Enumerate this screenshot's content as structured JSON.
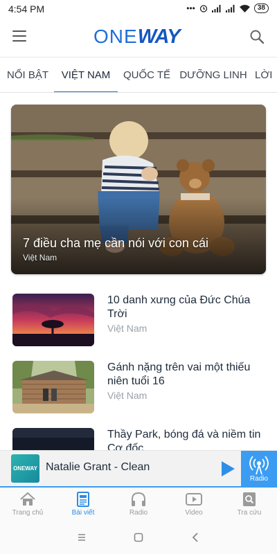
{
  "status_bar": {
    "time": "4:54 PM",
    "battery": "38",
    "icons": [
      "dots-icon",
      "alarm-icon",
      "signal-icon",
      "signal-icon",
      "wifi-icon",
      "battery-icon"
    ]
  },
  "header": {
    "logo_part1": "ONE",
    "logo_part2": "WAY",
    "menu_icon": "hamburger-icon",
    "search_icon": "search-icon"
  },
  "tabs": [
    {
      "label": "NỔI BẬT",
      "active": false
    },
    {
      "label": "VIỆT NAM",
      "active": true
    },
    {
      "label": "QUỐC TẾ",
      "active": false
    },
    {
      "label": "DƯỠNG LINH",
      "active": false
    },
    {
      "label": "LỜI",
      "active": false
    }
  ],
  "featured": {
    "title": "7 điều cha mẹ cần nói với con cái",
    "category": "Việt Nam"
  },
  "articles": [
    {
      "title": "10 danh xưng của Đức Chúa Trời",
      "category": "Việt Nam"
    },
    {
      "title": "Gánh nặng trên vai một thiếu niên tuổi 16",
      "category": "Việt Nam"
    },
    {
      "title": "Thầy Park, bóng đá và niềm tin Cơ đốc",
      "category": ""
    }
  ],
  "player": {
    "logo_text": "ONEWAY",
    "title": "Natalie Grant - Clean",
    "radio_label": "Radio"
  },
  "bottom_nav": [
    {
      "label": "Trang chủ",
      "icon": "home-icon",
      "active": false
    },
    {
      "label": "Bài viết",
      "icon": "article-icon",
      "active": true
    },
    {
      "label": "Radio",
      "icon": "headphones-icon",
      "active": false
    },
    {
      "label": "Video",
      "icon": "video-icon",
      "active": false
    },
    {
      "label": "Tra cứu",
      "icon": "lookup-icon",
      "active": false
    }
  ],
  "colors": {
    "accent": "#1e6fd9",
    "nav_active": "#2b8be6",
    "radio_bg": "#3b9cf2"
  }
}
